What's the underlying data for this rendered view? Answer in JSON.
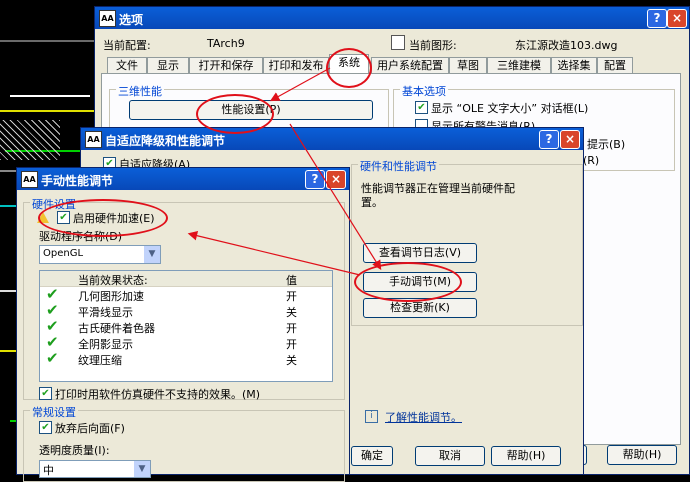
{
  "options_window": {
    "title": "选项",
    "current_config_label": "当前配置:",
    "current_config_value": "TArch9",
    "current_drawing_label": "当前图形:",
    "current_drawing_value": "东江源改造103.dwg",
    "tabs": [
      "文件",
      "显示",
      "打开和保存",
      "打印和发布",
      "系统",
      "用户系统配置",
      "草图",
      "三维建模",
      "选择集",
      "配置"
    ],
    "three_d_group": "三维性能",
    "perf_button": "性能设置(P)",
    "basic_group": "基本选项",
    "basic_options": [
      "显示 “OLE 文字大小” 对话框(L)",
      "显示所有警告消息(R)",
      "提示(B)",
      "(R)"
    ],
    "ok": "确定",
    "help": "帮助(H)"
  },
  "adaptive_window": {
    "title": "自适应降级和性能调节",
    "adaptive_checkbox": "自适应降级(A)",
    "hw_group": "硬件和性能调节",
    "hw_text_1": "性能调节器正在管理当前硬件配",
    "hw_text_2": "置。",
    "view_log_button": "查看调节日志(V)",
    "manual_button": "手动调节(M)",
    "check_update_button": "检查更新(K)",
    "learn_link": "了解性能调节。",
    "ok": "确定",
    "cancel": "取消",
    "help": "帮助(H)"
  },
  "manual_window": {
    "title": "手动性能调节",
    "hw_group": "硬件设置",
    "enable_hw": "启用硬件加速(E)",
    "driver_label": "驱动程序名称(D)",
    "driver_value": "OpenGL",
    "col_effect": "当前效果状态:",
    "col_value": "值",
    "effects": [
      {
        "name": "几何图形加速",
        "value": "开"
      },
      {
        "name": "平滑线显示",
        "value": "关"
      },
      {
        "name": "古氏硬件着色器",
        "value": "开"
      },
      {
        "name": "全阴影显示",
        "value": "开"
      },
      {
        "name": "纹理压缩",
        "value": "关"
      }
    ],
    "emulate_checkbox": "打印时用软件仿真硬件不支持的效果。(M)",
    "general_group": "常规设置",
    "discard_backface": "放弃后向面(F)",
    "transparency_label": "透明度质量(I):",
    "transparency_value": "中"
  },
  "colors": {
    "title_bar": "#0A5FD8",
    "annotation": "#E0101A",
    "check": "#1E9E1E"
  }
}
